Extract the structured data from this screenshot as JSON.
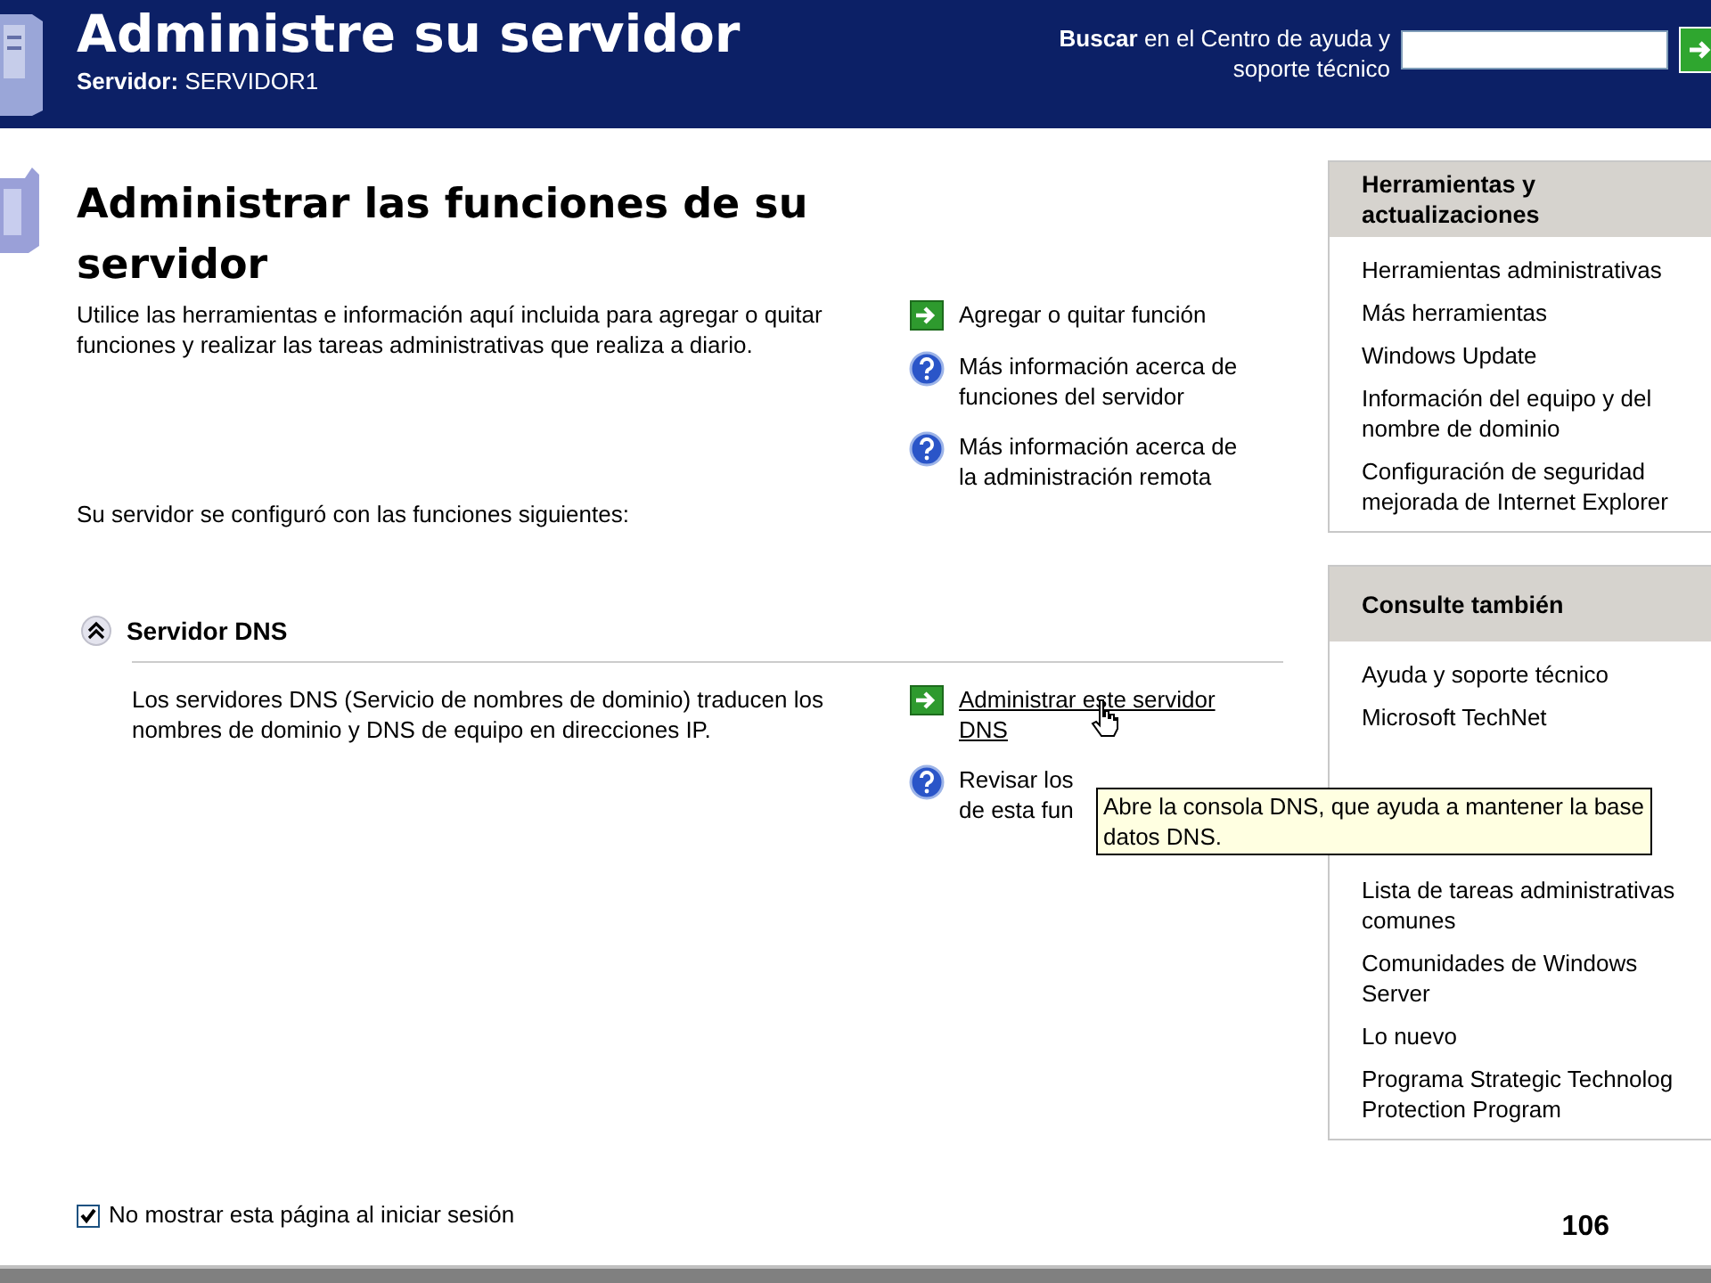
{
  "header": {
    "title": "Administre su servidor",
    "server_line": "**Servidor:** SERVIDOR1",
    "search_label": "**Buscar** en el Centro de ayuda y soporte técnico"
  },
  "main": {
    "title": "Administrar las funciones de su servidor",
    "description": "Utilice las herramientas e información aquí incluida para agregar o quitar funciones y realizar las tareas administrativas que realiza a diario.",
    "tasks": [
      {
        "kind": "action",
        "lines": [
          "Agregar o quitar función"
        ],
        "hovered": false
      },
      {
        "kind": "help",
        "lines": [
          "Más información acerca de",
          "funciones del servidor"
        ],
        "hovered": false
      },
      {
        "kind": "help",
        "lines": [
          "Más información acerca de",
          "la administración remota"
        ],
        "hovered": false
      }
    ],
    "configured_label": "Su servidor se configuró con las funciones siguientes:",
    "roles": [
      {
        "name": "Servidor DNS",
        "expanded": true,
        "description": "Los servidores DNS (Servicio de nombres de dominio) traducen los nombres de dominio y DNS de equipo en direcciones IP.",
        "tasks": [
          {
            "kind": "action",
            "lines": [
              "Administrar este servidor",
              "DNS"
            ],
            "hovered": true
          },
          {
            "kind": "help",
            "lines": [
              "Revisar los",
              "de esta fun"
            ],
            "hovered": false
          }
        ]
      }
    ]
  },
  "sidebar": [
    {
      "title": "Herramientas y actualizaciones",
      "items": [
        "Herramientas administrativas",
        "Más herramientas",
        "Windows Update",
        "Información del equipo y del nombre de dominio",
        "Configuración de seguridad mejorada de Internet Explorer"
      ]
    },
    {
      "title": "Consulte también",
      "items": [
        "Ayuda y soporte técnico",
        "Microsoft TechNet"
      ],
      "items_after": [
        "Lista de tareas administrativas comunes",
        "Comunidades de Windows Server",
        "Lo nuevo",
        "Programa Strategic Technolog Protection Program"
      ]
    }
  ],
  "tooltip": {
    "lines": [
      "Abre la consola DNS, que ayuda a mantener la base",
      "datos DNS."
    ]
  },
  "footer": {
    "checkbox": {
      "label": "No mostrar esta página al iniciar sesión",
      "checked": true
    },
    "page_number": "106"
  }
}
